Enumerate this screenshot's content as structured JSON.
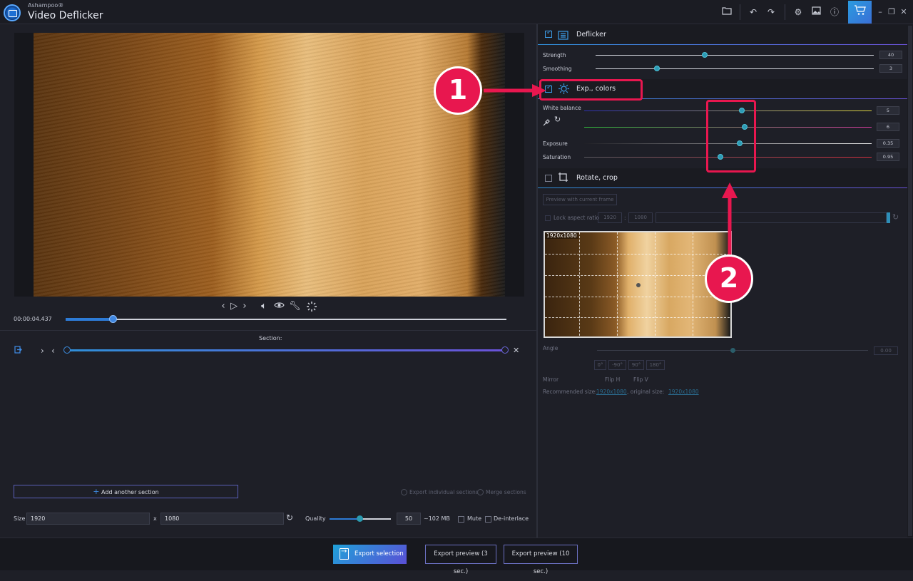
{
  "titlebar": {
    "brand": "Ashampoo®",
    "app_name": "Video Deflicker",
    "icons": [
      "folder-icon",
      "undo-icon",
      "redo-icon",
      "settings-icon",
      "image-icon",
      "info-icon",
      "cart-icon",
      "minimize-icon",
      "restore-icon",
      "close-icon"
    ]
  },
  "player": {
    "timecode": "00:00:04.437",
    "controls": [
      "prev-frame-icon",
      "play-icon",
      "next-frame-icon",
      "volume-icon",
      "eye-icon",
      "wrench-icon",
      "loading-icon"
    ],
    "progress_fraction": 0.107
  },
  "section": {
    "label": "Section:",
    "add_button": "Add another section",
    "export_individual": "Export individual sections",
    "merge": "Merge sections"
  },
  "output": {
    "size_label": "Size",
    "width": "1920",
    "x": "x",
    "height": "1080",
    "quality_label": "Quality",
    "quality_value": "50",
    "quality_fraction": 0.5,
    "estimated_size": "~102 MB",
    "mute": "Mute",
    "deinterlace": "De-interlace"
  },
  "bottom": {
    "export": "Export selection",
    "preview3": "Export preview (3 sec.)",
    "preview10": "Export preview (10 sec.)"
  },
  "deflicker": {
    "title": "Deflicker",
    "checked": true,
    "strength_label": "Strength",
    "strength_value": "40",
    "strength_fraction": 0.4,
    "smoothing_label": "Smoothing",
    "smoothing_value": "3",
    "smoothing_fraction": 0.22
  },
  "exposure_colors": {
    "title": "Exp., colors",
    "checked": true,
    "white_balance_label": "White balance",
    "wb1_value": "5",
    "wb2_value": "6",
    "exposure_label": "Exposure",
    "exposure_value": "0.35",
    "saturation_label": "Saturation",
    "saturation_value": "0.95"
  },
  "rotate_crop": {
    "title": "Rotate, crop",
    "checked": false,
    "preview_btn": "Preview with current frame",
    "lock_label": "Lock aspect ratio",
    "w": "1920",
    "colon": ":",
    "h": "1080",
    "preview_size_label": "1920x1080",
    "angle_label": "Angle",
    "angle_value": "0.00",
    "angle_buttons": [
      "0°",
      "-90°",
      "90°",
      "180°"
    ],
    "mirror_label": "Mirror",
    "flip_h": "Flip H",
    "flip_v": "Flip V",
    "recommended_label": "Recommended size:",
    "recommended_value": "1920x1080",
    "original_label": ", original size:",
    "original_value": "1920x1080"
  },
  "annotations": {
    "marker1": "1",
    "marker2": "2"
  },
  "colors": {
    "accent_blue": "#2d7bd6",
    "accent_purple": "#6a52d8",
    "highlight": "#e8174f",
    "knob": "#2d9bb5"
  }
}
